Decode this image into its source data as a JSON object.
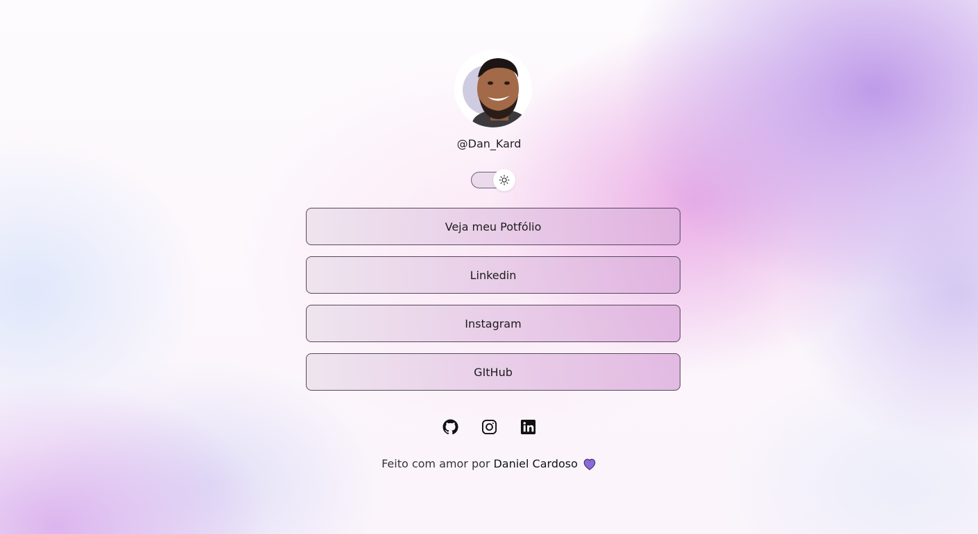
{
  "profile": {
    "username": "@Dan_Kard"
  },
  "theme_toggle": {
    "icon": "sun-icon",
    "state": "light"
  },
  "links": [
    {
      "label": "Veja meu Potfólio"
    },
    {
      "label": "Linkedin"
    },
    {
      "label": "Instagram"
    },
    {
      "label": "GItHub"
    }
  ],
  "socials": [
    {
      "icon": "github-icon"
    },
    {
      "icon": "instagram-icon"
    },
    {
      "icon": "linkedin-icon"
    }
  ],
  "footer": {
    "text": "Feito com amor por",
    "author": "Daniel Cardoso",
    "icon": "purple-heart-icon"
  },
  "colors": {
    "heart": "#8a6ad8",
    "text": "#1c1c1c",
    "button_border": "#55485a"
  }
}
